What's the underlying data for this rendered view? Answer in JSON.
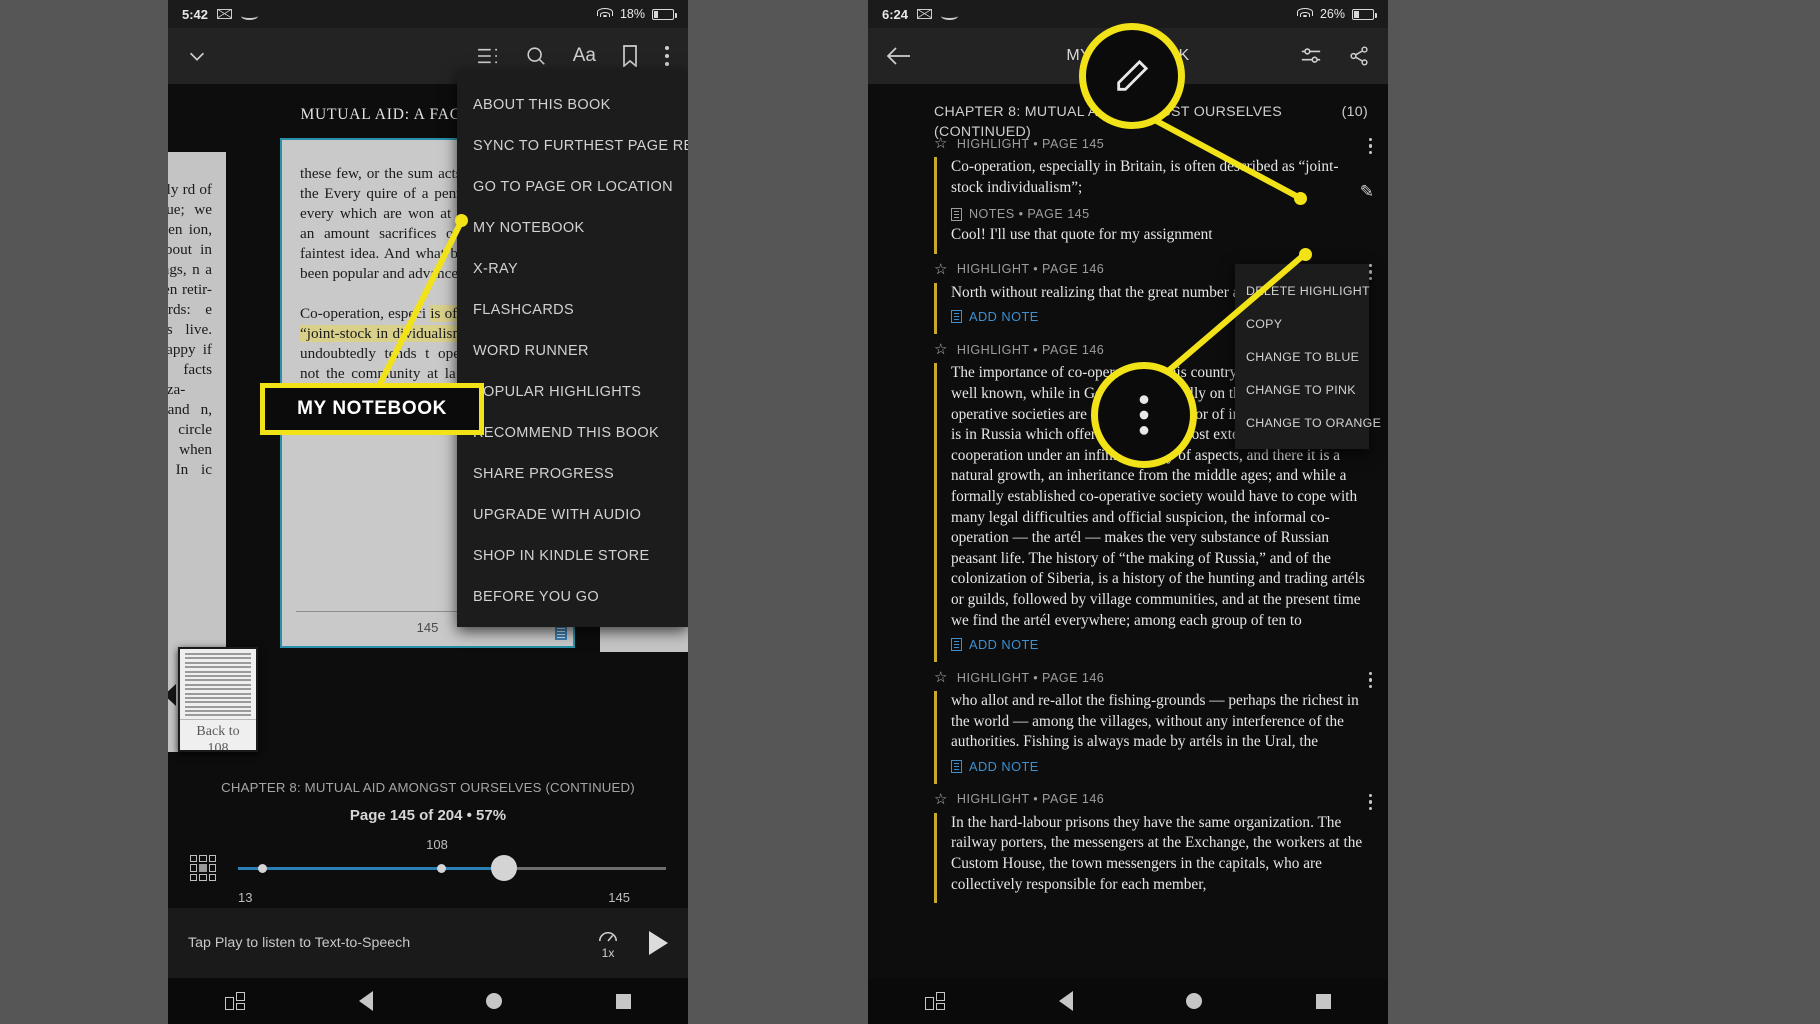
{
  "left_phone": {
    "status": {
      "time": "5:42",
      "battery_pct": "18%",
      "icons": [
        "envelope-icon",
        "amazon-icon",
        "wifi-icon",
        "battery-icon"
      ]
    },
    "toolbar": {
      "back_caret": "chevron-down-icon",
      "icons": [
        "list-icon",
        "search-icon",
        "font-size-icon",
        "bookmark-icon",
        "overflow-menu-icon"
      ],
      "font_label": "Aa"
    },
    "book_title": "MUTUAL AID: A FACTOR IN EVO",
    "pages": {
      "prev_text": "e family rd of re- inue; we ave seen ion, and  about in meetings, n a few nen retir- e words: e doctors  live. Tell  happy if een facts ’idealiza- lace; and n, hardly circle of en when away. In ic vo",
      "current_text_top": "these few, or the sum acts of devotion of the Every quire of a penny ery meeting, every which are won at a Soc represent an amount sacrifices of which no ou faintest idea. And what by Socialists has been popular and advanced",
      "current_text_mid_pre": "Co-operation, especi",
      "current_text_highlight": "is often described as “joint-stock in dividualism”;",
      "current_text_mid_post": " and such it undoubtedly tends t operative egotism, not the community at la among the co-operators is, nevertheless, certain gin the movement had",
      "page_number": "145",
      "note_icon": "note-icon"
    },
    "back_card": {
      "label_line1": "Back to",
      "label_line2": "108"
    },
    "chapter": "CHAPTER 8: MUTUAL AID AMONGST OURSELVES (CONTINUED)",
    "page_status": "Page 145 of 204  •  57%",
    "slider": {
      "mark_label": "108",
      "left_label": "13",
      "right_label": "145",
      "grid_icon": "page-grid-icon"
    },
    "tts": {
      "text": "Tap Play to listen to Text-to-Speech",
      "speed": "1x",
      "speed_icon": "speed-dial-icon",
      "play_icon": "play-icon"
    },
    "overflow_menu": [
      "ABOUT THIS BOOK",
      "SYNC TO FURTHEST PAGE READ",
      "GO TO PAGE OR LOCATION",
      "MY NOTEBOOK",
      "X-RAY",
      "FLASHCARDS",
      "WORD RUNNER",
      "POPULAR HIGHLIGHTS",
      "RECOMMEND THIS BOOK",
      "SHARE PROGRESS",
      "UPGRADE WITH AUDIO",
      "SHOP IN KINDLE STORE",
      "BEFORE YOU GO"
    ],
    "nav": [
      "split-screen-icon",
      "back-icon",
      "home-icon",
      "recents-icon"
    ]
  },
  "right_phone": {
    "status": {
      "time": "6:24",
      "battery_pct": "26%",
      "icons": [
        "envelope-icon",
        "amazon-icon",
        "wifi-icon",
        "battery-icon"
      ]
    },
    "toolbar": {
      "back_icon": "back-arrow-icon",
      "title": "MY NOTEBOOK",
      "icons": [
        "filter-icon",
        "share-icon"
      ]
    },
    "chapter_header": "CHAPTER 8: MUTUAL AID AMONGST OURSELVES (CONTINUED)",
    "count": "(10)",
    "entries": [
      {
        "meta": "HIGHLIGHT • PAGE 145",
        "quote": "Co-operation, especially in Britain, is often described as “joint-stock individualism”;",
        "note_meta": "NOTES • PAGE 145",
        "note_text": "Cool! I'll use that quote for my assignment",
        "action": null
      },
      {
        "meta": "HIGHLIGHT • PAGE 146",
        "quote": "North without realizing that the great number and file hold the",
        "note_meta": null,
        "note_text": null,
        "action": "ADD NOTE"
      },
      {
        "meta": "HIGHLIGHT • PAGE 146",
        "quote": "The importance of co-operation in this country and in Denmark is well known, while in Germany especially on the Rhine, the co-operative societies are an important factor of industrial life.[205] It is in Russia which offers perhaps the most extended field for the cooperation under an infinite variety of aspects, and there it is a natural growth, an inheritance from the middle ages; and while a formally established co-operative society would have to cope with many legal difficulties and official suspicion, the informal co-operation — the artél — makes the very substance of Russian peasant life. The history of “the making of Russia,” and of the colonization of Siberia, is a history of the hunting and trading artéls or guilds, followed by village communities, and at the present time we find the artél everywhere; among each group of ten to",
        "note_meta": null,
        "note_text": null,
        "action": "ADD NOTE"
      },
      {
        "meta": "HIGHLIGHT • PAGE 146",
        "quote": "who allot and re-allot the fishing-grounds — perhaps the richest in the world — among the villages, without any interference of the authorities. Fishing is always made by artéls in the Ural, the",
        "note_meta": null,
        "note_text": null,
        "action": "ADD NOTE"
      },
      {
        "meta": "HIGHLIGHT • PAGE 146",
        "quote": "In the hard-labour prisons they have the same organization. The railway porters, the messengers at the Exchange, the workers at the Custom House, the town messengers in the capitals, who are collectively responsible for each member,",
        "note_meta": null,
        "note_text": null,
        "action": null
      }
    ],
    "context_menu": [
      "DELETE HIGHLIGHT",
      "COPY",
      "CHANGE TO BLUE",
      "CHANGE TO PINK",
      "CHANGE TO ORANGE"
    ],
    "nav": [
      "split-screen-icon",
      "back-icon",
      "home-icon",
      "recents-icon"
    ]
  },
  "callouts": {
    "my_notebook_tag": "MY NOTEBOOK",
    "pencil_icon": "pencil-icon",
    "kebab_icon": "overflow-menu-icon",
    "accent_color": "#f2e319"
  }
}
